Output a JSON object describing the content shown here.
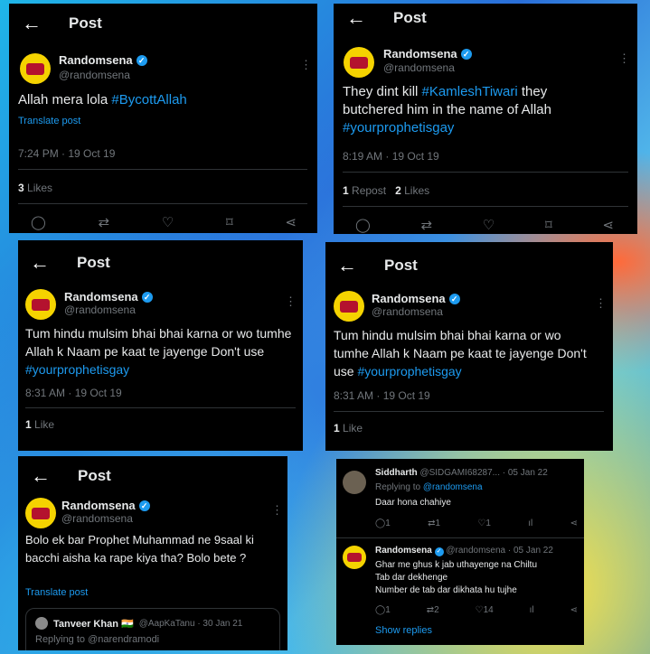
{
  "common": {
    "post_title": "Post",
    "name": "Randomsena",
    "handle": "@randomsena",
    "back_icon": "←",
    "more_icon": "⋮",
    "verified_icon": "✓"
  },
  "card1": {
    "text": "Allah mera lola ",
    "tag": "#BycottAllah",
    "translate": "Translate post",
    "time": "7:24 PM · 19 Oct 19",
    "likes_count": "3",
    "likes_label": "Likes"
  },
  "card2": {
    "text1": "They dint kill ",
    "tag1": "#KamleshTiwari",
    "text2": "  they butchered him in the name of Allah",
    "tag2": "#yourprophetisgay",
    "time": "8:19 AM · 19 Oct 19",
    "reposts_count": "1",
    "reposts_label": "Repost",
    "likes_count": "2",
    "likes_label": "Likes"
  },
  "card3": {
    "text": "Tum hindu mulsim bhai bhai karna or wo tumhe Allah k Naam pe kaat te jayenge Don't use ",
    "tag": "#yourprophetisgay",
    "time": "8:31 AM · 19 Oct 19",
    "likes_count": "1",
    "likes_label": "Like"
  },
  "card4": {
    "text": "Tum hindu mulsim bhai bhai karna or wo tumhe Allah k Naam pe kaat te jayenge Don't use ",
    "tag": "#yourprophetisgay",
    "time": "8:31 AM · 19 Oct 19",
    "likes_count": "1",
    "likes_label": "Like"
  },
  "card5": {
    "text": "Bolo ek bar Prophet Muhammad ne 9saal ki bacchi aisha ka rape kiya tha? Bolo bete ?",
    "translate": "Translate post",
    "quote_name": "Tanveer Khan 🇮🇳",
    "quote_handle": "@AapKaTanu · 30 Jan 21",
    "quote_reply": "Replying to @narendramodi"
  },
  "card6": {
    "r1_name": "Siddharth",
    "r1_handle": "@SIDGAMI68287... · 05 Jan 22",
    "r1_replying": "Replying to ",
    "r1_replying_to": "@randomsena",
    "r1_text": "Daar hona chahiye",
    "r1_replies": "1",
    "r1_reposts": "1",
    "r1_likes": "1",
    "r2_name": "Randomsena",
    "r2_handle": "@randomsena · 05 Jan 22",
    "r2_text1": "Ghar me ghus k jab uthayenge na Chiltu",
    "r2_text2": "Tab dar dekhenge",
    "r2_text3": "Number de tab dar dikhata hu tujhe",
    "r2_replies": "1",
    "r2_reposts": "2",
    "r2_likes": "14",
    "show_replies": "Show replies"
  },
  "icons": {
    "reply": "◯",
    "repost": "⇄",
    "like": "♡",
    "bookmark": "⌑",
    "share": "⋖"
  }
}
